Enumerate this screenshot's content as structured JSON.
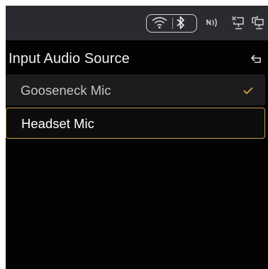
{
  "status_bar": {
    "icons": [
      "wifi-icon",
      "bluetooth-icon",
      "nfc-icon",
      "network-off-icon",
      "network-icon"
    ],
    "icon_color": "#cfd0d4"
  },
  "header": {
    "title": "Input Audio Source",
    "back_icon": "back-icon"
  },
  "sources": [
    {
      "label": "Gooseneck Mic",
      "selected": true
    },
    {
      "label": "Headset Mic",
      "selected": false,
      "focused": true
    }
  ],
  "colors": {
    "background": "#030303",
    "status_bar": "#2a2b30",
    "accent": "#c79a3c",
    "item_background": "#1c1c1e"
  }
}
